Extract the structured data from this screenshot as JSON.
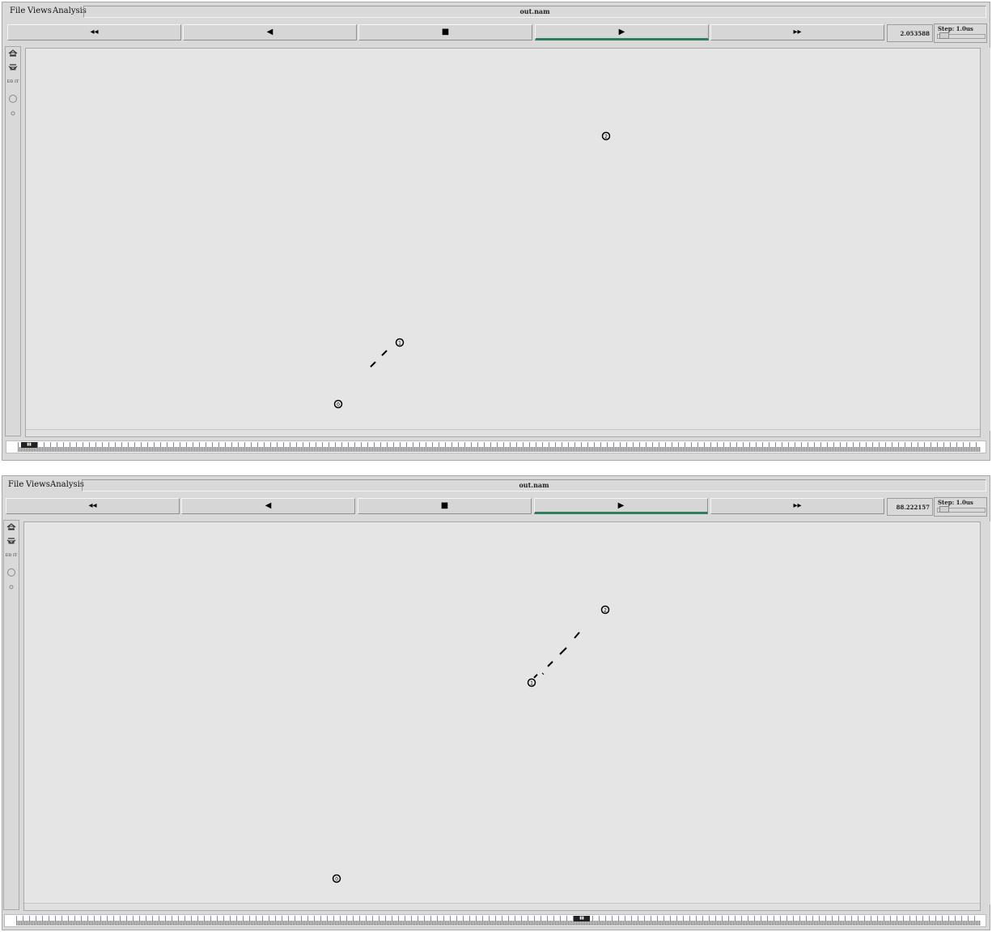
{
  "windows": [
    {
      "menu": {
        "file": "File",
        "views": "Views",
        "analysis": "Analysis"
      },
      "title": "out.nam",
      "controls": {
        "rewind": "◂◂",
        "back": "◀",
        "stop": "■",
        "play": "▶",
        "forward": "▸▸"
      },
      "time": "2.053588",
      "step": "Step: 1.0us",
      "tools": {
        "edit": "ED IT"
      },
      "nodes": [
        {
          "id": "0",
          "label": "0"
        },
        {
          "id": "1",
          "label": "1"
        },
        {
          "id": "2",
          "label": "2"
        }
      ],
      "timeline_progress": 0.0
    },
    {
      "menu": {
        "file": "File",
        "views": "Views",
        "analysis": "Analysis"
      },
      "title": "out.nam",
      "controls": {
        "rewind": "◂◂",
        "back": "◀",
        "stop": "■",
        "play": "▶",
        "forward": "▸▸"
      },
      "time": "88.222157",
      "step": "Step: 1.0us",
      "tools": {
        "edit": "ED IT"
      },
      "nodes": [
        {
          "id": "0",
          "label": "0"
        },
        {
          "id": "1",
          "label": "1"
        },
        {
          "id": "2",
          "label": "2"
        }
      ],
      "timeline_progress": 0.59
    }
  ],
  "colors": {
    "accent": "#2e7d5b",
    "timeline_ticks": "#7c86cc"
  }
}
